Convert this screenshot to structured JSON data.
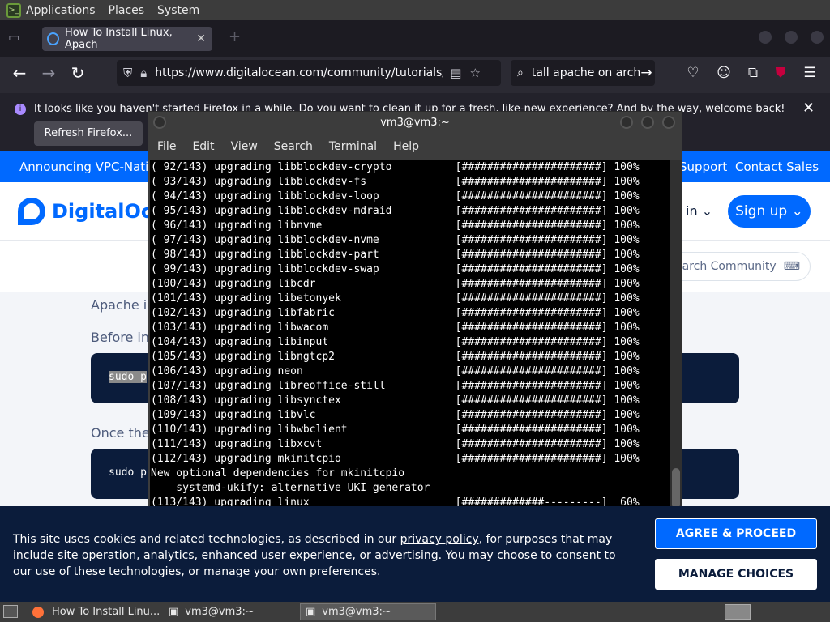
{
  "topbar": {
    "menus": [
      "Applications",
      "Places",
      "System"
    ]
  },
  "browser": {
    "tab_title": "How To Install Linux, Apach",
    "url": "https://www.digitalocean.com/community/tutorials/how",
    "search": "tall apache on arch",
    "notification": "It looks like you haven't started Firefox in a while. Do you want to clean it up for a fresh, like-new experience? And by the way, welcome back!",
    "refresh_btn": "Refresh Firefox..."
  },
  "site": {
    "announce": "Announcing VPC-Native",
    "announce_right": [
      "Support",
      "Contact Sales"
    ],
    "brand": "DigitalOce",
    "login": "in",
    "signup": "Sign up",
    "search": "earch Community",
    "paragraphs": [
      "Apache is",
      "Before ins",
      "Once the"
    ],
    "code": [
      "sudo p",
      "sudo p"
    ],
    "accent": "#0069ff"
  },
  "terminal": {
    "title": "vm3@vm3:~",
    "menus": [
      "File",
      "Edit",
      "View",
      "Search",
      "Terminal",
      "Help"
    ],
    "lines": [
      "( 92/143) upgrading libblockdev-crypto          [######################] 100%",
      "( 93/143) upgrading libblockdev-fs              [######################] 100%",
      "( 94/143) upgrading libblockdev-loop            [######################] 100%",
      "( 95/143) upgrading libblockdev-mdraid          [######################] 100%",
      "( 96/143) upgrading libnvme                     [######################] 100%",
      "( 97/143) upgrading libblockdev-nvme            [######################] 100%",
      "( 98/143) upgrading libblockdev-part            [######################] 100%",
      "( 99/143) upgrading libblockdev-swap            [######################] 100%",
      "(100/143) upgrading libcdr                      [######################] 100%",
      "(101/143) upgrading libetonyek                  [######################] 100%",
      "(102/143) upgrading libfabric                   [######################] 100%",
      "(103/143) upgrading libwacom                    [######################] 100%",
      "(104/143) upgrading libinput                    [######################] 100%",
      "(105/143) upgrading libngtcp2                   [######################] 100%",
      "(106/143) upgrading neon                        [######################] 100%",
      "(107/143) upgrading libreoffice-still           [######################] 100%",
      "(108/143) upgrading libsynctex                  [######################] 100%",
      "(109/143) upgrading libvlc                      [######################] 100%",
      "(110/143) upgrading libwbclient                 [######################] 100%",
      "(111/143) upgrading libxcvt                     [######################] 100%",
      "(112/143) upgrading mkinitcpio                  [######################] 100%",
      "New optional dependencies for mkinitcpio",
      "    systemd-ukify: alternative UKI generator",
      "(113/143) upgrading linux                       [#############---------]  60%"
    ]
  },
  "cookie": {
    "text_before": "This site uses cookies and related technologies, as described in our ",
    "link": "privacy policy",
    "text_after": ", for purposes that may include site operation, analytics, enhanced user experience, or advertising. You may choose to consent to our use of these technologies, or manage your own preferences.",
    "agree": "AGREE & PROCEED",
    "manage": "MANAGE CHOICES"
  },
  "taskbar": {
    "items": [
      "How To Install Linu...",
      "vm3@vm3:~",
      "vm3@vm3:~"
    ]
  }
}
